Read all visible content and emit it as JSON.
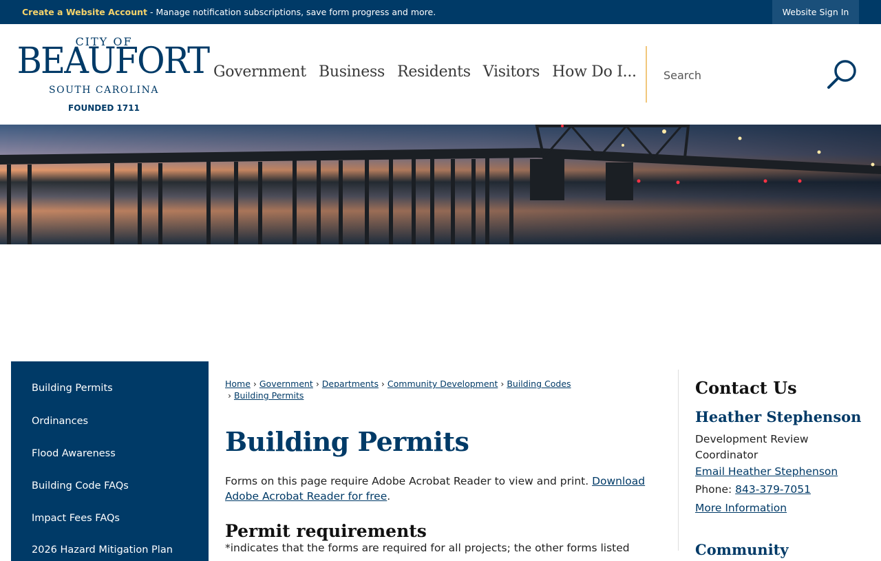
{
  "topbar": {
    "create_link": "Create a Website Account",
    "message": " - Manage notification subscriptions, save form progress and more.",
    "signin": "Website Sign In"
  },
  "logo": {
    "city_of": "CITY OF",
    "name": "BEAUFORT",
    "state": "SOUTH CAROLINA",
    "founded": "FOUNDED 1711"
  },
  "nav": {
    "items": [
      "Government",
      "Business",
      "Residents",
      "Visitors",
      "How Do I..."
    ]
  },
  "search": {
    "placeholder": "Search"
  },
  "sidebar": {
    "items": [
      "Building Permits",
      "Ordinances",
      "Flood Awareness",
      "Building Code FAQs",
      "Impact Fees FAQs",
      "2026 Hazard Mitigation Plan"
    ]
  },
  "breadcrumb": [
    "Home",
    "Government",
    "Departments",
    "Community Development",
    "Building Codes",
    "Building Permits"
  ],
  "main": {
    "title": "Building Permits",
    "intro_text": "Forms on this page require Adobe Acrobat Reader to view and print. ",
    "intro_link": "Download Adobe Acrobat Reader for free",
    "intro_end": ".",
    "section_heading": "Permit requirements",
    "section_note": "*indicates that the forms are required for all projects; the other forms listed"
  },
  "contact": {
    "heading": "Contact Us",
    "name": "Heather Stephenson",
    "title": "Development Review Coordinator",
    "email_link": "Email Heather Stephenson",
    "phone_label": "Phone: ",
    "phone": "843-379-7051",
    "more": "More Information",
    "next_heading": "Community"
  },
  "colors": {
    "brand_navy": "#003a67",
    "accent_gold": "#f5d36b",
    "divider_gold": "#f1c77c"
  }
}
